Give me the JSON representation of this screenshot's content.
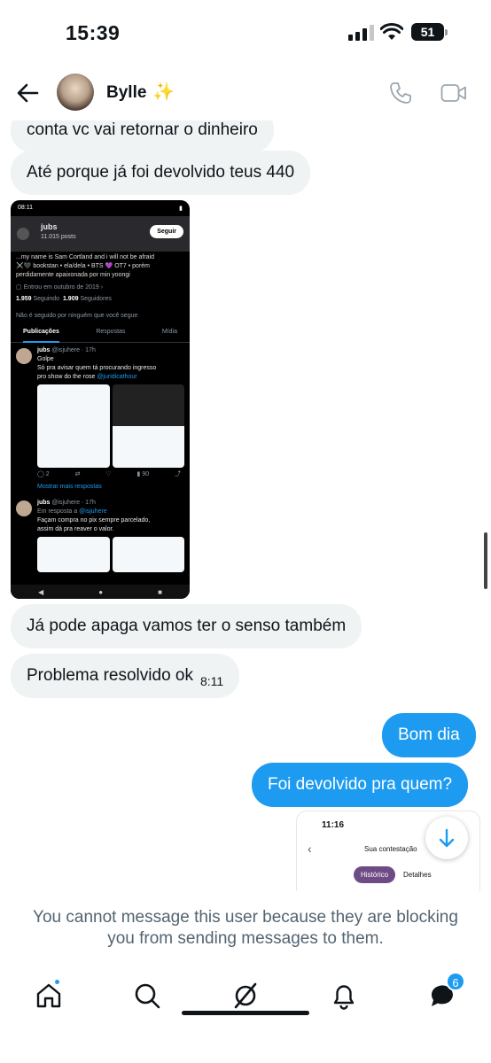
{
  "status_bar": {
    "time": "15:39",
    "battery": "51"
  },
  "header": {
    "name": "Bylle",
    "sparkle": "✨"
  },
  "messages": [
    {
      "dir": "in",
      "text": "conta vc vai retornar o dinheiro"
    },
    {
      "dir": "in",
      "text": "Até porque já foi devolvido teus 440"
    },
    {
      "dir": "in",
      "text": "Já pode apaga vamos ter o senso também"
    },
    {
      "dir": "in",
      "text": "Problema resolvido ok",
      "time": "8:11"
    },
    {
      "dir": "out",
      "text": "Bom dia"
    },
    {
      "dir": "out",
      "text": "Foi devolvido pra quem?"
    }
  ],
  "embedded_screenshot": {
    "time": "08:11",
    "profile_name": "jubs",
    "posts": "11.015 posts",
    "follow_button": "Seguir",
    "bio_1": "...my name is Sam Cortland and i will not be afraid",
    "bio_2": "⚔️🖤 bookstan • ela/dela • BTS 💜 OT7 • porém",
    "bio_3": "perdidamente apaixonada por min yoongi",
    "joined": "Entrou em outubro de 2019",
    "following_count": "1.959",
    "following_label": "Seguindo",
    "followers_count": "1.909",
    "followers_label": "Seguidores",
    "not_followed": "Não é seguido por ninguém que você segue",
    "tabs": [
      "Publicações",
      "Respostas",
      "Mídia"
    ],
    "tweet1_name": "jubs",
    "tweet1_meta": "@isjuhere · 17h",
    "tweet1_l1": "Golpe",
    "tweet1_l2": "Só pra avisar quem tá procurando ingresso",
    "tweet1_l3": "pro show do the rose",
    "tweet1_mention": "@juridicathour",
    "tweet1_replies": "2",
    "tweet1_views": "90",
    "show_more": "Mostrar mais respostas",
    "tweet2_name": "jubs",
    "tweet2_meta": "@isjuhere · 17h",
    "tweet2_reply_to": "Em resposta a",
    "tweet2_reply_handle": "@isjuhere",
    "tweet2_l1": "Façam compra no pix sempre parcelado,",
    "tweet2_l2": "assim dá pra reaver o valor."
  },
  "sent_thumbnail": {
    "time": "11:16",
    "title": "Sua contestação",
    "tab_active": "Histórico",
    "tab_other": "Detalhes"
  },
  "blocked_notice": "You cannot message this user because they are blocking you from sending messages to them.",
  "tabbar": {
    "messages_badge": "6"
  },
  "colors": {
    "accent": "#1d9bf0",
    "incoming_bubble": "#eff3f4",
    "text": "#0f1419",
    "muted": "#536471"
  }
}
